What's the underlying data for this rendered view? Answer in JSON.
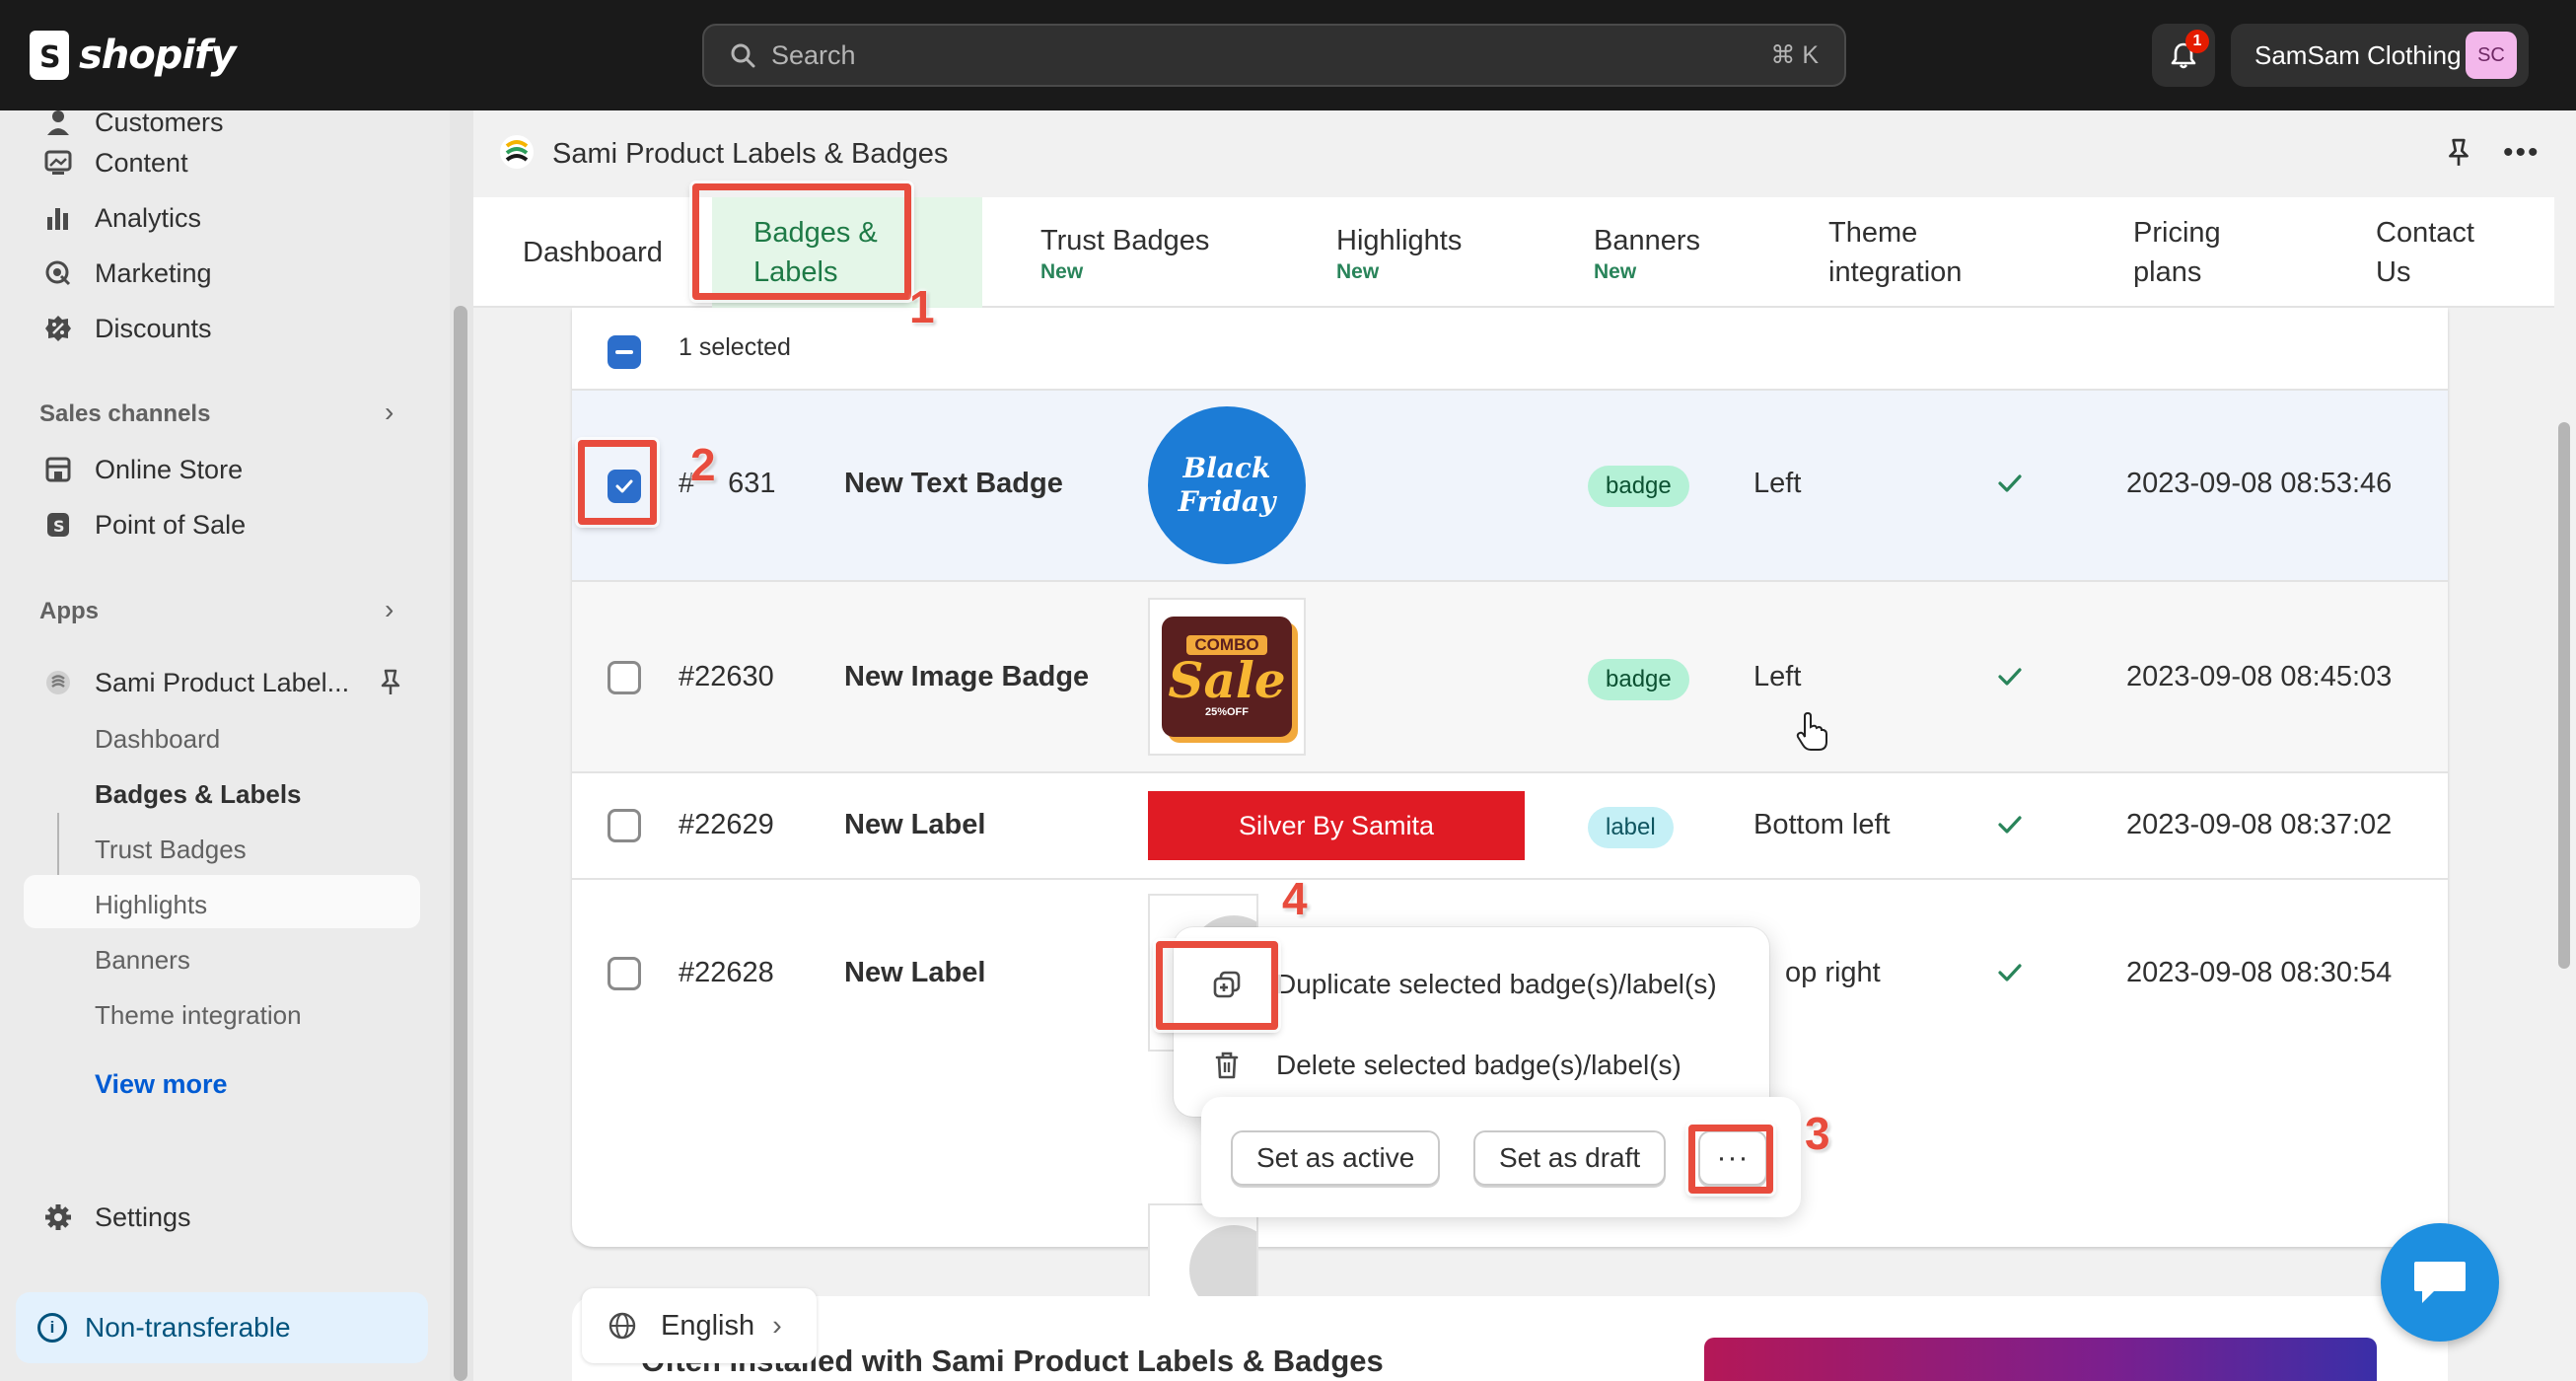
{
  "topbar": {
    "logo_text": "shopify",
    "search_placeholder": "Search",
    "search_shortcut": "⌘ K",
    "notification_count": "1",
    "store_name": "SamSam Clothing",
    "avatar_initials": "SC"
  },
  "sidebar": {
    "top_items": [
      {
        "label": "Customers",
        "icon": "person-icon"
      },
      {
        "label": "Content",
        "icon": "content-icon"
      },
      {
        "label": "Analytics",
        "icon": "analytics-icon"
      },
      {
        "label": "Marketing",
        "icon": "marketing-icon"
      },
      {
        "label": "Discounts",
        "icon": "discount-icon"
      }
    ],
    "sales_channels_heading": "Sales channels",
    "sales_channels": [
      {
        "label": "Online Store",
        "icon": "store-icon"
      },
      {
        "label": "Point of Sale",
        "icon": "pos-icon"
      }
    ],
    "apps_heading": "Apps",
    "app_name": "Sami Product Label...",
    "app_subitems": [
      "Dashboard",
      "Badges & Labels",
      "Trust Badges",
      "Highlights",
      "Banners",
      "Theme integration"
    ],
    "active_subitem": "Badges & Labels",
    "view_more": "View more",
    "settings": "Settings",
    "non_transferable": "Non-transferable"
  },
  "app_header": {
    "title": "Sami Product Labels & Badges"
  },
  "tabs": [
    {
      "label": "Dashboard",
      "new": ""
    },
    {
      "label": "Badges & Labels",
      "new": ""
    },
    {
      "label": "Trust Badges",
      "new": "New"
    },
    {
      "label": "Highlights",
      "new": "New"
    },
    {
      "label": "Banners",
      "new": "New"
    },
    {
      "label": "Theme integration",
      "new": ""
    },
    {
      "label": "Pricing plans",
      "new": ""
    },
    {
      "label": "Contact Us",
      "new": ""
    }
  ],
  "table": {
    "selected_text": "1 selected",
    "rows": [
      {
        "id": "#22631",
        "name": "New Text Badge",
        "type": "badge",
        "position": "Left",
        "date": "2023-09-08 08:53:46",
        "checked": true,
        "preview_text": [
          "Black",
          "Friday"
        ]
      },
      {
        "id": "#22630",
        "name": "New Image Badge",
        "type": "badge",
        "position": "Left",
        "date": "2023-09-08 08:45:03",
        "checked": false,
        "preview_text": [
          "COMBO",
          "Sale",
          "25%OFF"
        ]
      },
      {
        "id": "#22629",
        "name": "New Label",
        "type": "label",
        "position": "Bottom left",
        "date": "2023-09-08 08:37:02",
        "checked": false,
        "preview_text": [
          "Silver By Samita"
        ]
      },
      {
        "id": "#22628",
        "name": "New Label",
        "type": "",
        "position": "Top right",
        "date": "2023-09-08 08:30:54",
        "checked": false,
        "preview_text": []
      }
    ],
    "visible_id_first": "#",
    "visible_id_first_rest": "631",
    "visible_position_last": "op right"
  },
  "menu": {
    "duplicate": "Duplicate selected badge(s)/label(s)",
    "delete": "Delete selected badge(s)/label(s)"
  },
  "bulk_actions": {
    "set_active": "Set as active",
    "set_draft": "Set as draft",
    "more": "···"
  },
  "annotations": [
    "1",
    "2",
    "3",
    "4"
  ],
  "footer": {
    "language": "English",
    "promo_title": "Often installed with Sami Product Labels & Badges"
  },
  "colors": {
    "accent_blue": "#2c6ecb",
    "annotation_red": "#e84c3d",
    "badge_green": "#b4f1d6",
    "label_teal": "#c5f0f6",
    "tab_active_bg": "#e4f6e8"
  }
}
